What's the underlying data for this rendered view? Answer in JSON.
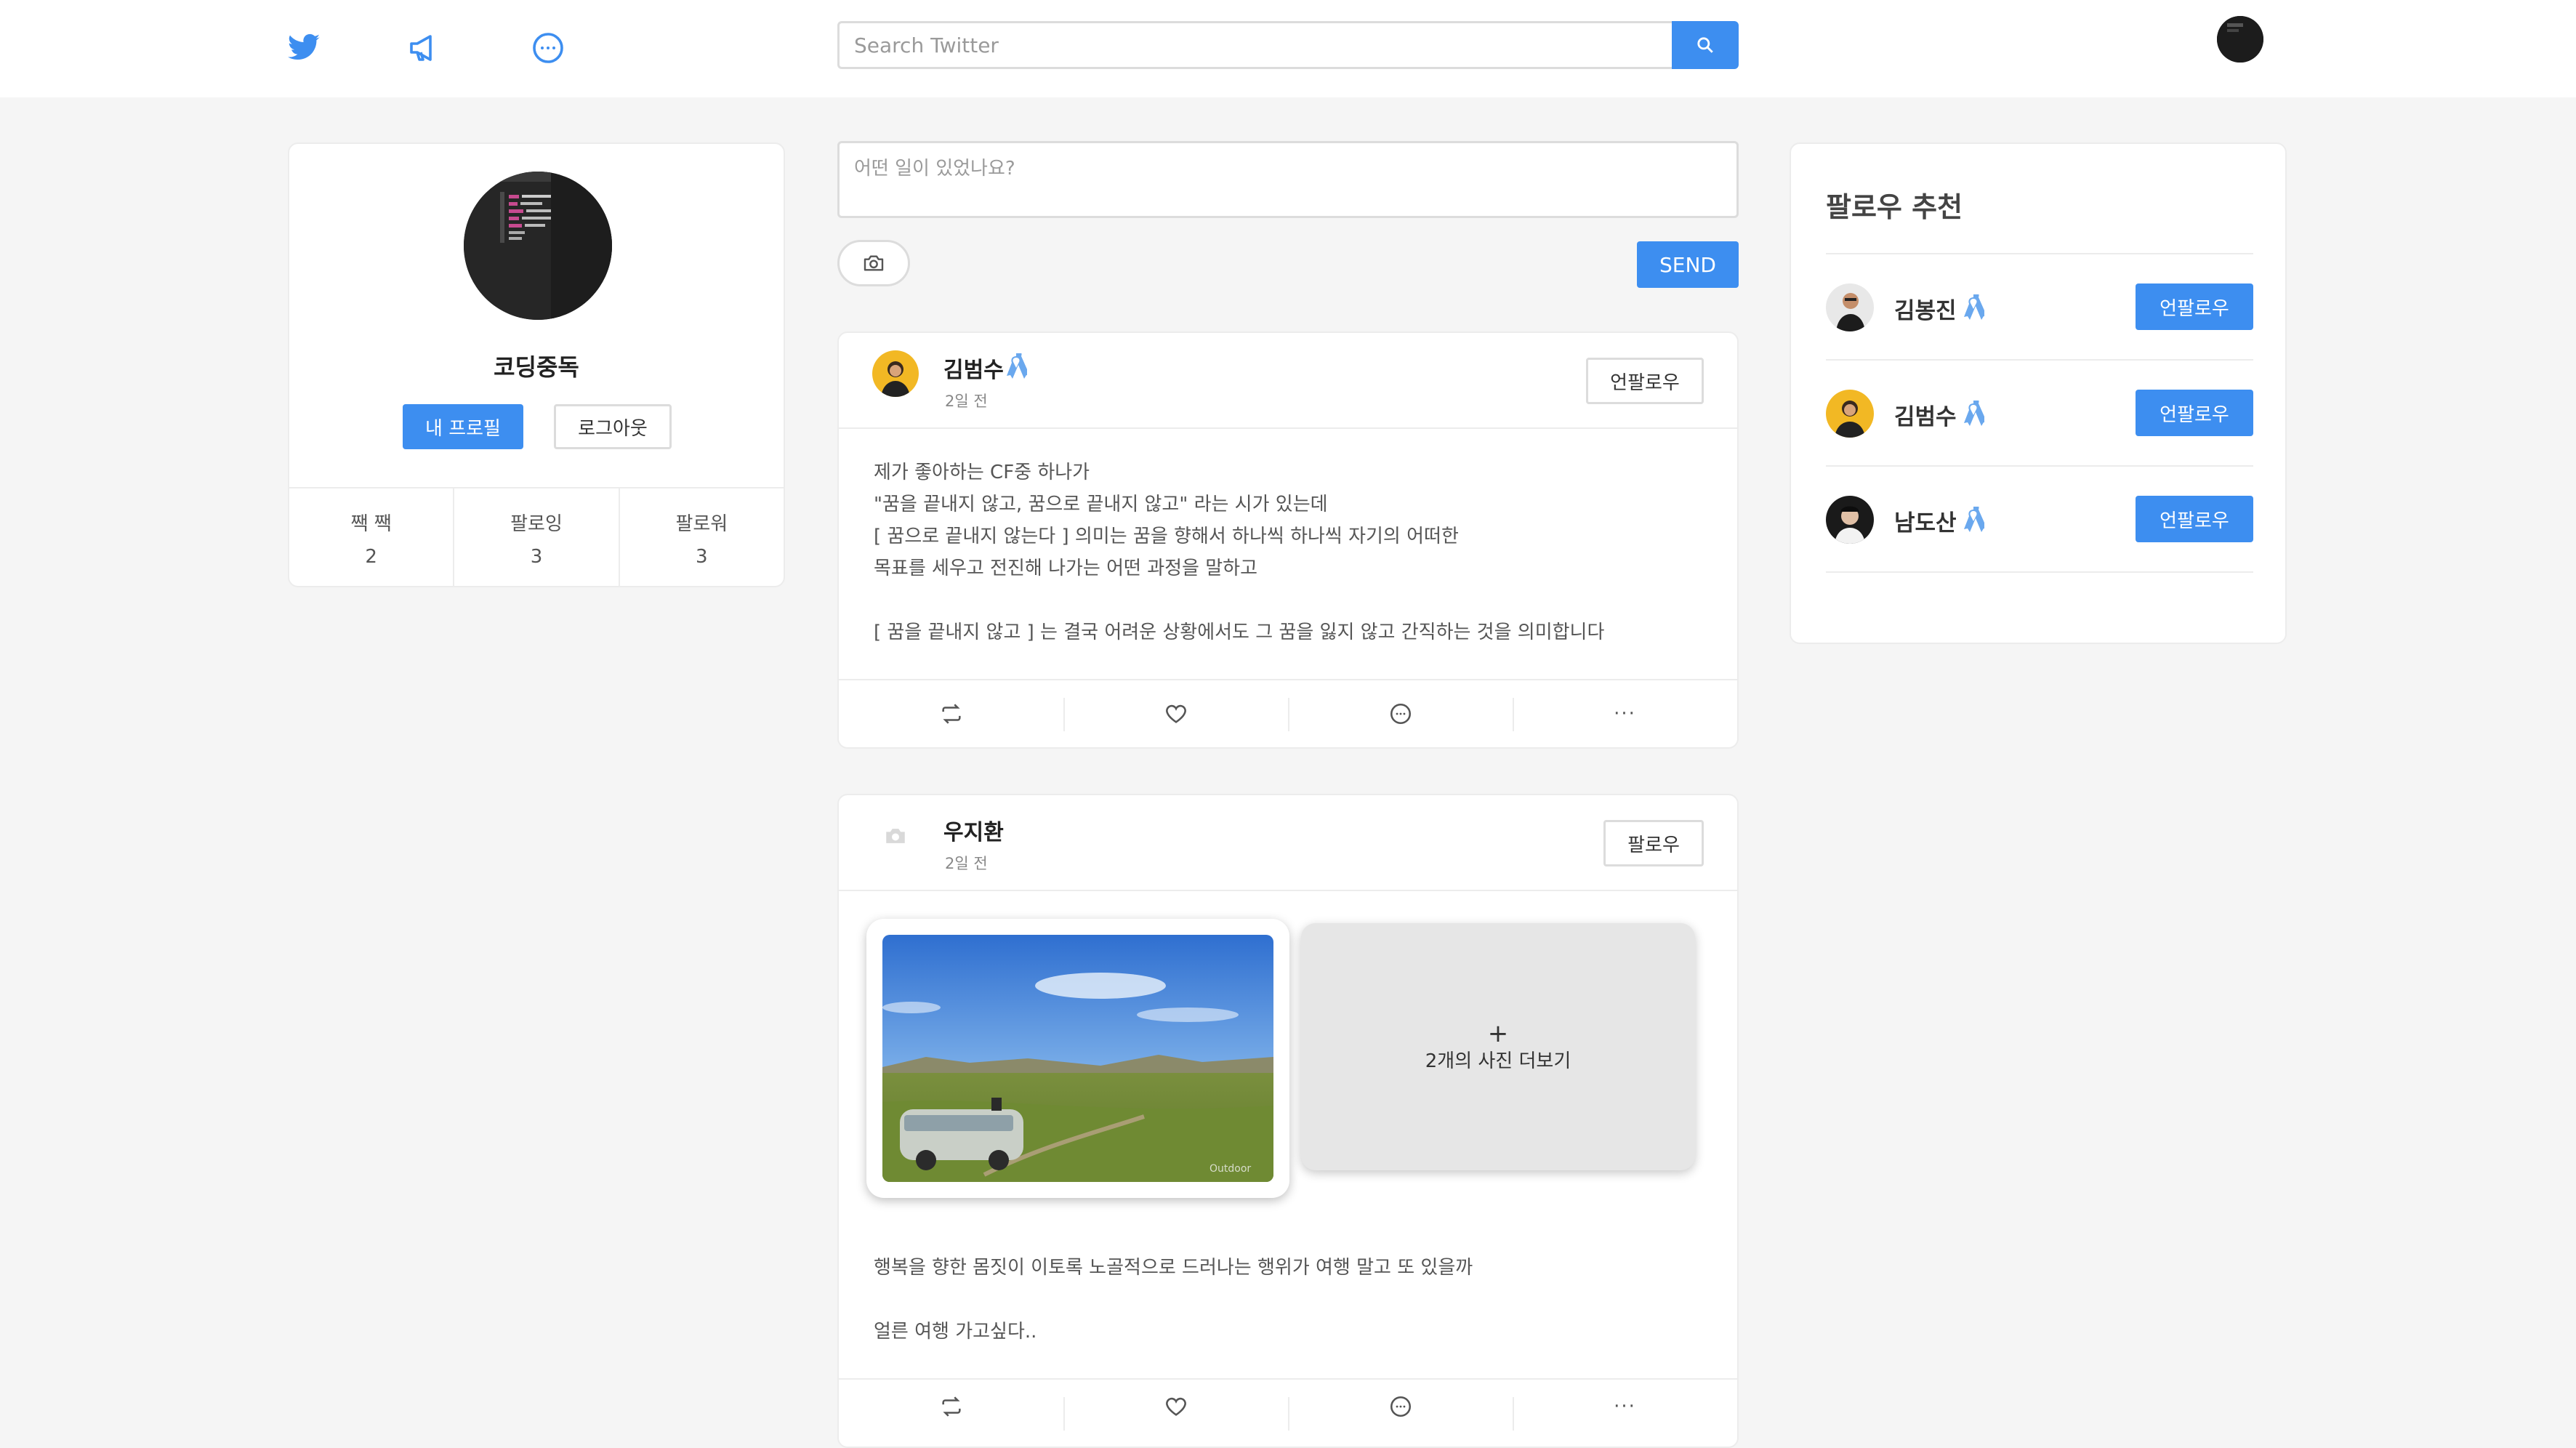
{
  "header": {
    "search_placeholder": "Search Twitter"
  },
  "colors": {
    "accent": "#3d8ef0",
    "background": "#f5f5f5",
    "card_border": "#ececec"
  },
  "profile": {
    "name": "코딩중독",
    "my_profile_label": "내 프로필",
    "logout_label": "로그아웃",
    "stats": [
      {
        "label": "짹 짹",
        "value": "2"
      },
      {
        "label": "팔로잉",
        "value": "3"
      },
      {
        "label": "팔로워",
        "value": "3"
      }
    ]
  },
  "compose": {
    "placeholder": "어떤 일이 있었나요?",
    "send_label": "SEND"
  },
  "posts": [
    {
      "author": "김범수",
      "time": "2일 전",
      "follow_label": "언팔로우",
      "body": "제가 좋아하는 CF중 하나가\n\"꿈을 끝내지 않고, 꿈으로 끝내지 않고\" 라는 시가 있는데\n[ 꿈으로 끝내지 않는다 ] 의미는 꿈을 향해서 하나씩 하나씩 자기의 어떠한\n목표를 세우고 전진해 나가는 어떤 과정을 말하고\n\n[ 꿈을 끝내지 않고 ] 는 결국 어려운 상황에서도 그 꿈을 잃지 않고 간직하는 것을 의미합니다",
      "more_symbol": "···"
    },
    {
      "author": "우지환",
      "time": "2일 전",
      "follow_label": "팔로우",
      "photo_watermark": "Outdoor",
      "more_photos_plus": "+",
      "more_photos_label": "2개의 사진 더보기",
      "body": "행복을 향한 몸짓이 이토록 노골적으로 드러나는 행위가 여행 말고 또 있을까\n\n얼른 여행 가고싶다..",
      "more_symbol": "···"
    }
  ],
  "suggestions": {
    "title": "팔로우 추천",
    "items": [
      {
        "name": "김봉진",
        "button_label": "언팔로우"
      },
      {
        "name": "김범수",
        "button_label": "언팔로우"
      },
      {
        "name": "남도산",
        "button_label": "언팔로우"
      }
    ]
  },
  "icons": [
    "twitter-bird-icon",
    "megaphone-icon",
    "chat-bubble-icon",
    "search-icon",
    "camera-icon",
    "retweet-icon",
    "heart-icon",
    "comment-icon",
    "more-icon",
    "ribbon-icon"
  ]
}
